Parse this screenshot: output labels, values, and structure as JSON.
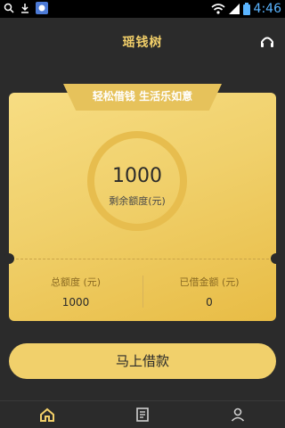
{
  "status_bar": {
    "time": "4:46"
  },
  "header": {
    "title": "瑶钱树",
    "headset_icon": "headset-icon"
  },
  "card": {
    "banner": "轻松借钱 生活乐如意",
    "amount": "1000",
    "amount_label": "剩余额度(元)",
    "stats": [
      {
        "label": "总额度 (元)",
        "value": "1000"
      },
      {
        "label": "已借金额 (元)",
        "value": "0"
      }
    ]
  },
  "cta": {
    "label": "马上借款"
  },
  "tabbar": {
    "items": [
      {
        "icon": "home-icon"
      },
      {
        "icon": "list-icon"
      },
      {
        "icon": "user-icon"
      }
    ]
  },
  "colors": {
    "background": "#2b2b2b",
    "accent": "#f2cf69",
    "card": "#f0d06b"
  }
}
